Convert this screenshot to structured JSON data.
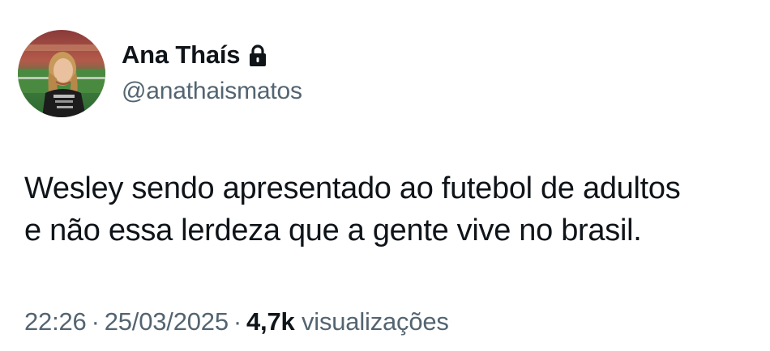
{
  "author": {
    "display_name": "Ana Thaís",
    "handle": "@anathaismatos",
    "avatar_icon": "profile-photo",
    "lock_icon": "lock-icon"
  },
  "tweet": {
    "text_lines": [
      "Wesley sendo apresentado ao futebol de adultos",
      "e não essa lerdeza que a gente vive no brasil."
    ]
  },
  "meta": {
    "time": "22:26",
    "separator": "·",
    "date": "25/03/2025",
    "views_count": "4,7k",
    "views_label": "visualizações"
  },
  "colors": {
    "primary_text": "#0f1419",
    "secondary_text": "#536471",
    "background": "#ffffff"
  }
}
